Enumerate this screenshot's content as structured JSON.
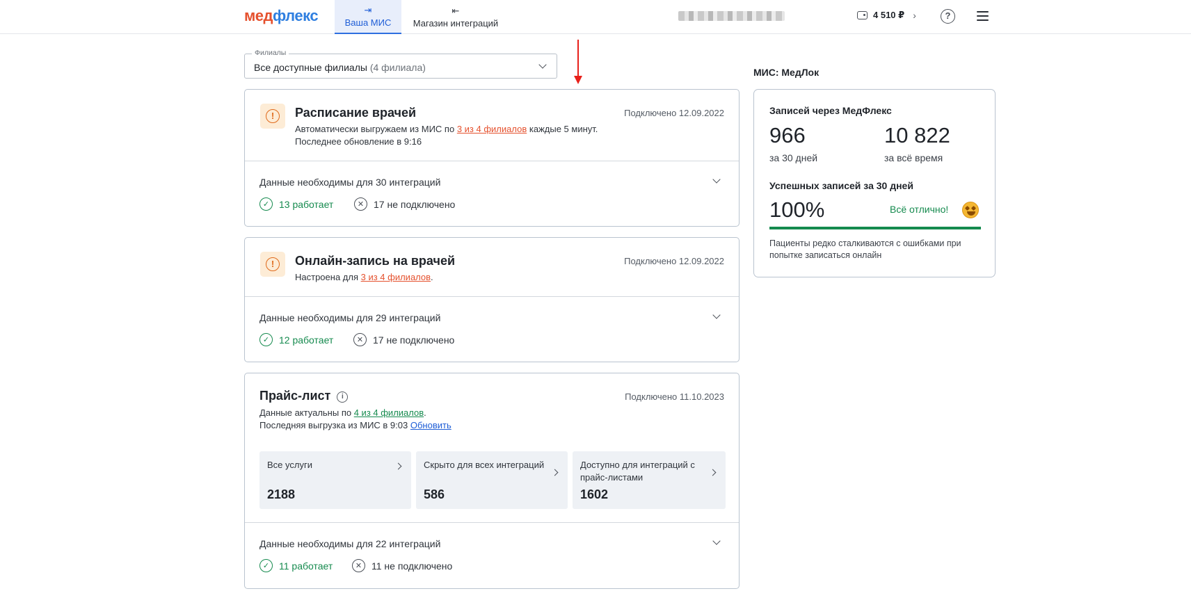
{
  "header": {
    "logo_part1": "мед",
    "logo_part2": "флекс",
    "tabs": [
      {
        "label": "Ваша МИС",
        "icon": "login-arrow-icon",
        "active": true
      },
      {
        "label": "Магазин интеграций",
        "icon": "logout-arrow-icon",
        "active": false
      }
    ],
    "balance": "4 510 ₽"
  },
  "branch_select": {
    "legend": "Филиалы",
    "value": "Все доступные филиалы",
    "count": "(4 филиала)"
  },
  "cards": [
    {
      "title": "Расписание врачей",
      "date": "Подключено 12.09.2022",
      "desc_prefix": "Автоматически выгружаем из МИС по",
      "desc_link": "3 из 4 филиалов",
      "desc_suffix": "каждые 5 минут.",
      "desc_line2": "Последнее обновление в 9:16",
      "need": "Данные необходимы для 30 интеграций",
      "ok": "13 работает",
      "off": "17 не подключено"
    },
    {
      "title": "Онлайн-запись на врачей",
      "date": "Подключено 12.09.2022",
      "desc_prefix": "Настроена для",
      "desc_link": "3 из 4 филиалов",
      "desc_suffix": ".",
      "need": "Данные необходимы для 29 интеграций",
      "ok": "12 работает",
      "off": "17 не подключено"
    },
    {
      "title": "Прайс-лист",
      "date": "Подключено 11.10.2023",
      "desc_prefix": "Данные актуальны по",
      "desc_link": "4 из 4 филиалов",
      "desc_suffix": ".",
      "desc_line2": "Последняя выгрузка из МИС в 9:03",
      "update_link": "Обновить",
      "tiles": [
        {
          "label": "Все услуги",
          "value": "2188"
        },
        {
          "label": "Скрыто для всех интеграций",
          "value": "586"
        },
        {
          "label": "Доступно для интеграций с прайс-листами",
          "value": "1602"
        }
      ],
      "need": "Данные необходимы для 22 интеграций",
      "ok": "11 работает",
      "off": "11 не подключено"
    }
  ],
  "side": {
    "mis_label": "МИС: МедЛок",
    "records_title": "Записей через МедФлекс",
    "records_30": "966",
    "records_30_sub": "за 30 дней",
    "records_all": "10 822",
    "records_all_sub": "за всё время",
    "success_title": "Успешных записей за 30 дней",
    "success_value": "100%",
    "success_fraction": 1.0,
    "success_note": "Всё отлично!",
    "footer": "Пациенты редко сталкиваются с ошибками при попытке записаться онлайн"
  },
  "colors": {
    "accent_orange": "#e5512e",
    "accent_blue": "#2f7fe0",
    "success_green": "#158a4e",
    "warning_orange": "#e06a1b"
  }
}
